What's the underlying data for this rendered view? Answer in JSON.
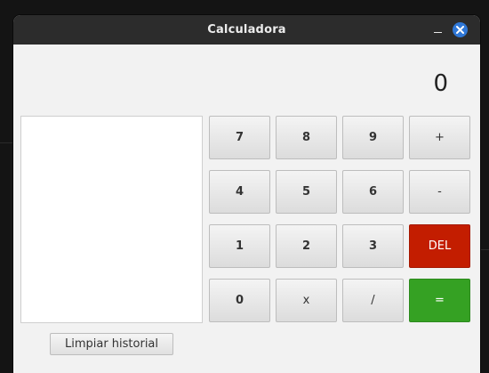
{
  "window": {
    "title": "Calculadora"
  },
  "display": {
    "value": "0"
  },
  "keypad": [
    [
      "7",
      "8",
      "9",
      "+"
    ],
    [
      "4",
      "5",
      "6",
      "-"
    ],
    [
      "1",
      "2",
      "3",
      "DEL"
    ],
    [
      "0",
      "x",
      "/",
      "="
    ]
  ],
  "history": {
    "clear_label": "Limpiar historial"
  },
  "colors": {
    "delete": "#c31d00",
    "equals": "#35a123",
    "close": "#2f77d6"
  },
  "icons": {
    "minimize": "minimize-icon",
    "close": "close-icon"
  }
}
